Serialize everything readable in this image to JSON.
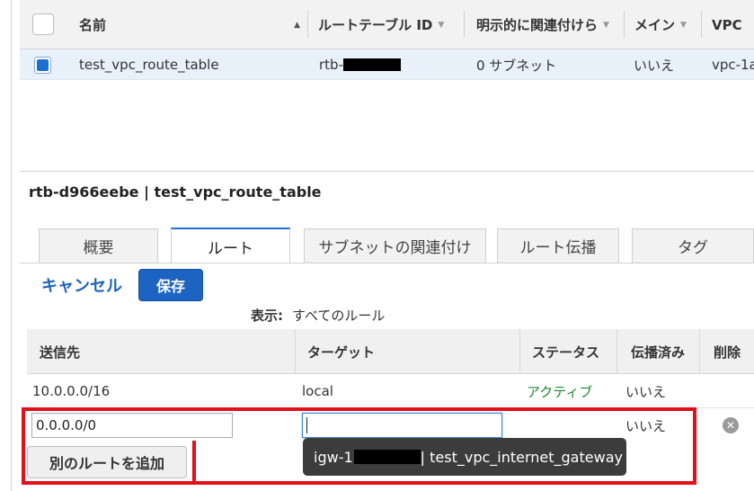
{
  "top_table": {
    "columns": {
      "name": "名前",
      "route_table_id": "ルートテーブル ID",
      "explicit_assoc": "明示的に関連付けら",
      "main": "メイン",
      "vpc": "VPC"
    },
    "rows": [
      {
        "name": "test_vpc_route_table",
        "route_table_id_prefix": "rtb-",
        "explicit_assoc": "0 サブネット",
        "main": "いいえ",
        "vpc": "vpc-1a"
      }
    ]
  },
  "detail": {
    "title": "rtb-d966eebe | test_vpc_route_table"
  },
  "tabs": [
    {
      "label": "概要",
      "active": false
    },
    {
      "label": "ルート",
      "active": true
    },
    {
      "label": "サブネットの関連付け",
      "active": false
    },
    {
      "label": "ルート伝播",
      "active": false
    },
    {
      "label": "タグ",
      "active": false
    }
  ],
  "actions": {
    "cancel_label": "キャンセル",
    "save_label": "保存"
  },
  "filter": {
    "label": "表示:",
    "value": "すべてのルール"
  },
  "routes_table": {
    "columns": {
      "destination": "送信先",
      "target": "ターゲット",
      "status": "ステータス",
      "propagated": "伝播済み",
      "delete": "削除"
    },
    "rows": [
      {
        "destination": "10.0.0.0/16",
        "target": "local",
        "status": "アクティブ",
        "propagated": "いいえ"
      }
    ],
    "new_row": {
      "destination_value": "0.0.0.0/0",
      "target_value": "",
      "propagated": "いいえ"
    }
  },
  "add_route_label": "別のルートを追加",
  "tooltip": {
    "prefix": "igw-1",
    "suffix": "| test_vpc_internet_gateway"
  },
  "colors": {
    "accent_blue": "#1d63c1",
    "active_status": "#1d8a2e",
    "highlight_red": "#e3101c"
  }
}
